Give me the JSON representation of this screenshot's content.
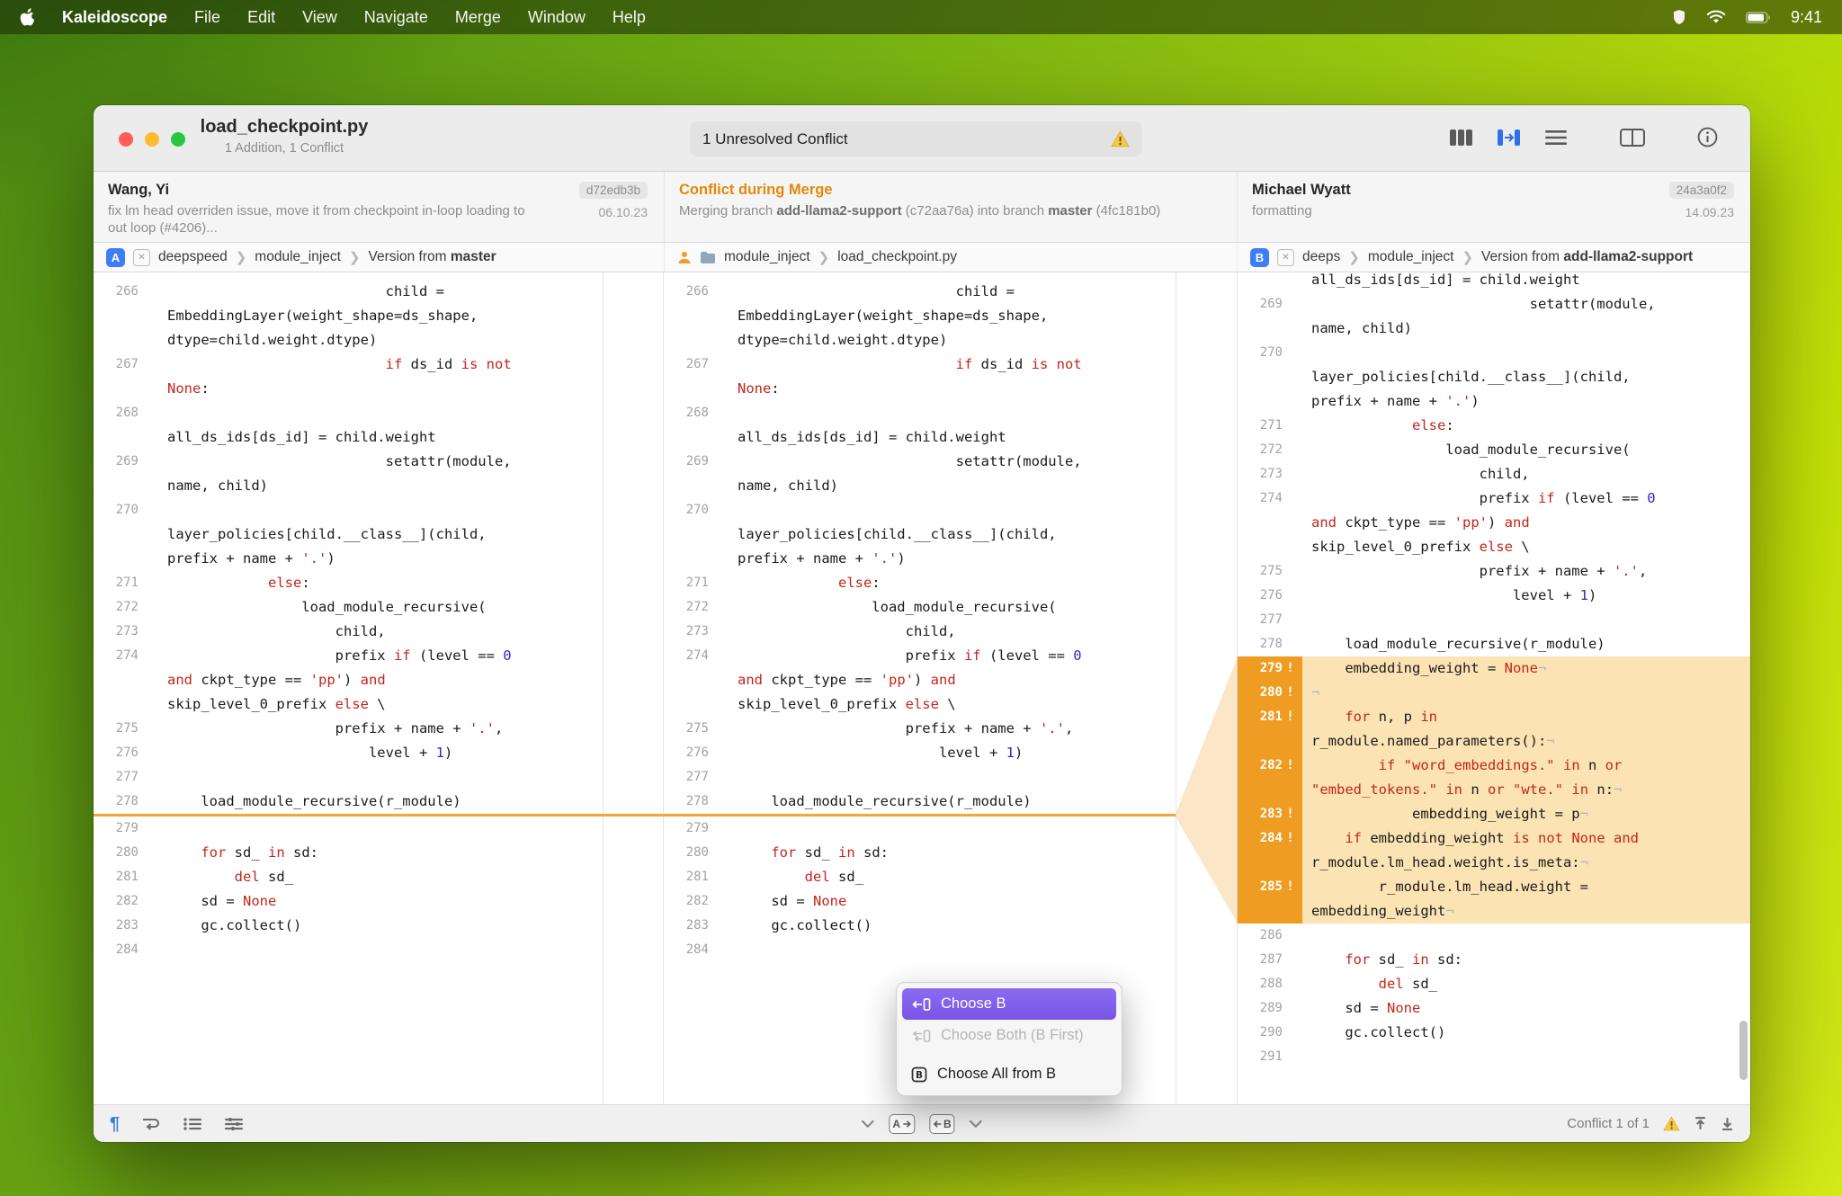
{
  "menubar": {
    "app_name": "Kaleidoscope",
    "menus": [
      "File",
      "Edit",
      "View",
      "Navigate",
      "Merge",
      "Window",
      "Help"
    ],
    "time": "9:41"
  },
  "titlebar": {
    "title": "load_checkpoint.py",
    "subtitle": "1 Addition, 1 Conflict",
    "banner": "1 Unresolved Conflict"
  },
  "commits": {
    "left": {
      "author": "Wang, Yi",
      "hash": "d72edb3b",
      "date": "06.10.23",
      "message": "fix lm head overriden issue, move it from checkpoint in-loop loading to out loop (#4206)..."
    },
    "middle": {
      "title": "Conflict during Merge",
      "pre": "Merging branch ",
      "branch_b": "add-llama2-support",
      "mid": " (c72aa76a) into branch ",
      "branch_a": "master",
      "post": " (4fc181b0)"
    },
    "right": {
      "author": "Michael Wyatt",
      "hash": "24a3a0f2",
      "date": "14.09.23",
      "message": "formatting"
    }
  },
  "crumbs": {
    "left": {
      "badge": "A",
      "s1": "deepspeed",
      "s2": "module_inject",
      "s3": "Version from ",
      "bold": "master"
    },
    "middle": {
      "s1": "module_inject",
      "s2": "load_checkpoint.py"
    },
    "right": {
      "badge": "B",
      "s1": "deeps",
      "s2": "module_inject",
      "s3": "Version from ",
      "bold": "add-llama2-support"
    }
  },
  "icons": {
    "menubar_right": [
      "shield-icon",
      "wifi-icon",
      "battery-icon"
    ],
    "view_modes": [
      "columns-view-icon",
      "merge-view-icon",
      "unified-view-icon",
      "fluid-view-icon",
      "info-icon"
    ],
    "statusbar_left": [
      "show-invisibles-icon",
      "wrap-lines-icon",
      "list-icon",
      "display-options-icon"
    ],
    "statusbar_center": [
      "chevron-down-icon",
      "choose-a-button",
      "choose-b-button",
      "chevron-down-icon"
    ],
    "statusbar_right": [
      "warning-icon",
      "previous-conflict-icon",
      "next-conflict-icon"
    ]
  },
  "popup": {
    "items": [
      {
        "label": "Choose B",
        "state": "selected"
      },
      {
        "label": "Choose Both (B First)",
        "state": "disabled"
      },
      {
        "label": "Choose All from B",
        "state": "normal"
      }
    ]
  },
  "statusbar": {
    "conflict_label": "Conflict 1 of 1"
  },
  "colors": {
    "accent_blue": "#3d7df5",
    "conflict_orange": "#e2890b",
    "highlight_gutter": "#ef9c23",
    "highlight_row": "#fbe3b4",
    "selection_purple": "#7a56e8"
  },
  "panes": {
    "ao": [
      {
        "n": "266",
        "r": [
          [
            [
              "p",
              "                          child ="
            ]
          ],
          [
            [
              "p",
              "EmbeddingLayer(weight_shape=ds_shape,"
            ]
          ],
          [
            [
              "p",
              "dtype=child.weight.dtype)"
            ]
          ]
        ]
      },
      {
        "n": "267",
        "r": [
          [
            [
              "p",
              "                          "
            ],
            [
              "k",
              "if"
            ],
            [
              "p",
              " ds_id "
            ],
            [
              "k",
              "is"
            ],
            [
              "p",
              " "
            ],
            [
              "k",
              "not"
            ]
          ],
          [
            [
              "k",
              "None"
            ],
            [
              "p",
              ":"
            ]
          ]
        ]
      },
      {
        "n": "268",
        "r": [
          [],
          [
            [
              "p",
              "all_ds_ids[ds_id] = child.weight"
            ]
          ]
        ]
      },
      {
        "n": "269",
        "r": [
          [
            [
              "p",
              "                          setattr(module,"
            ]
          ],
          [
            [
              "p",
              "name, child)"
            ]
          ]
        ]
      },
      {
        "n": "270",
        "r": [
          [],
          [
            [
              "p",
              "layer_policies[child.__class__](child,"
            ]
          ],
          [
            [
              "p",
              "prefix + name + "
            ],
            [
              "s",
              "'.'"
            ],
            [
              "p",
              ")"
            ]
          ]
        ]
      },
      {
        "n": "271",
        "r": [
          [
            [
              "p",
              "            "
            ],
            [
              "k",
              "else"
            ],
            [
              "p",
              ":"
            ]
          ]
        ]
      },
      {
        "n": "272",
        "r": [
          [
            [
              "p",
              "                load_module_recursive("
            ]
          ]
        ]
      },
      {
        "n": "273",
        "r": [
          [
            [
              "p",
              "                    child,"
            ]
          ]
        ]
      },
      {
        "n": "274",
        "r": [
          [
            [
              "p",
              "                    prefix "
            ],
            [
              "k",
              "if"
            ],
            [
              "p",
              " (level == "
            ],
            [
              "n",
              "0"
            ]
          ],
          [
            [
              "k",
              "and"
            ],
            [
              "p",
              " ckpt_type == "
            ],
            [
              "s",
              "'pp'"
            ],
            [
              "p",
              ") "
            ],
            [
              "k",
              "and"
            ]
          ],
          [
            [
              "p",
              "skip_level_0_prefix "
            ],
            [
              "k",
              "else"
            ],
            [
              "p",
              " \\"
            ]
          ]
        ]
      },
      {
        "n": "275",
        "r": [
          [
            [
              "p",
              "                    prefix + name + "
            ],
            [
              "s",
              "'.'"
            ],
            [
              "p",
              ","
            ]
          ]
        ]
      },
      {
        "n": "276",
        "r": [
          [
            [
              "p",
              "                        level + "
            ],
            [
              "n",
              "1"
            ],
            [
              "p",
              ")"
            ]
          ]
        ]
      },
      {
        "n": "277",
        "r": [
          []
        ]
      },
      {
        "n": "278",
        "r": [
          [
            [
              "p",
              "    load_module_recursive(r_module)"
            ]
          ]
        ]
      },
      {
        "mk": true
      },
      {
        "n": "279",
        "r": [
          []
        ]
      },
      {
        "n": "280",
        "r": [
          [
            [
              "p",
              "    "
            ],
            [
              "k",
              "for"
            ],
            [
              "p",
              " sd_ "
            ],
            [
              "k",
              "in"
            ],
            [
              "p",
              " sd:"
            ]
          ]
        ]
      },
      {
        "n": "281",
        "r": [
          [
            [
              "p",
              "        "
            ],
            [
              "k",
              "del"
            ],
            [
              "p",
              " sd_"
            ]
          ]
        ]
      },
      {
        "n": "282",
        "r": [
          [
            [
              "p",
              "    sd = "
            ],
            [
              "k",
              "None"
            ]
          ]
        ]
      },
      {
        "n": "283",
        "r": [
          [
            [
              "p",
              "    gc.collect()"
            ]
          ]
        ]
      },
      {
        "n": "284",
        "r": [
          []
        ]
      }
    ],
    "b": [
      {
        "n": "",
        "r": [
          [
            [
              "p",
              "all_ds_ids[ds_id] = child.weight"
            ]
          ]
        ]
      },
      {
        "n": "269",
        "r": [
          [
            [
              "p",
              "                          setattr(module,"
            ]
          ],
          [
            [
              "p",
              "name, child)"
            ]
          ]
        ]
      },
      {
        "n": "270",
        "r": [
          [],
          [
            [
              "p",
              "layer_policies[child.__class__](child,"
            ]
          ],
          [
            [
              "p",
              "prefix + name + "
            ],
            [
              "s",
              "'.'"
            ],
            [
              "p",
              ")"
            ]
          ]
        ]
      },
      {
        "n": "271",
        "r": [
          [
            [
              "p",
              "            "
            ],
            [
              "k",
              "else"
            ],
            [
              "p",
              ":"
            ]
          ]
        ]
      },
      {
        "n": "272",
        "r": [
          [
            [
              "p",
              "                load_module_recursive("
            ]
          ]
        ]
      },
      {
        "n": "273",
        "r": [
          [
            [
              "p",
              "                    child,"
            ]
          ]
        ]
      },
      {
        "n": "274",
        "r": [
          [
            [
              "p",
              "                    prefix "
            ],
            [
              "k",
              "if"
            ],
            [
              "p",
              " (level == "
            ],
            [
              "n",
              "0"
            ]
          ],
          [
            [
              "k",
              "and"
            ],
            [
              "p",
              " ckpt_type == "
            ],
            [
              "s",
              "'pp'"
            ],
            [
              "p",
              ") "
            ],
            [
              "k",
              "and"
            ]
          ],
          [
            [
              "p",
              "skip_level_0_prefix "
            ],
            [
              "k",
              "else"
            ],
            [
              "p",
              " \\"
            ]
          ]
        ]
      },
      {
        "n": "275",
        "r": [
          [
            [
              "p",
              "                    prefix + name + "
            ],
            [
              "s",
              "'.'"
            ],
            [
              "p",
              ","
            ]
          ]
        ]
      },
      {
        "n": "276",
        "r": [
          [
            [
              "p",
              "                        level + "
            ],
            [
              "n",
              "1"
            ],
            [
              "p",
              ")"
            ]
          ]
        ]
      },
      {
        "n": "277",
        "r": [
          []
        ]
      },
      {
        "n": "278",
        "r": [
          [
            [
              "p",
              "    load_module_recursive(r_module)"
            ]
          ]
        ]
      },
      {
        "n": "279",
        "h": true,
        "r": [
          [
            [
              "p",
              "    embedding_weight = "
            ],
            [
              "k",
              "None"
            ],
            [
              "m",
              "¬"
            ]
          ]
        ]
      },
      {
        "n": "280",
        "h": true,
        "r": [
          [
            [
              "m",
              "¬"
            ]
          ]
        ]
      },
      {
        "n": "281",
        "h": true,
        "r": [
          [
            [
              "p",
              "    "
            ],
            [
              "k",
              "for"
            ],
            [
              "p",
              " n, p "
            ],
            [
              "k",
              "in"
            ]
          ],
          [
            [
              "p",
              "r_module.named_parameters():"
            ],
            [
              "m",
              "¬"
            ]
          ]
        ]
      },
      {
        "n": "282",
        "h": true,
        "r": [
          [
            [
              "p",
              "        "
            ],
            [
              "k",
              "if"
            ],
            [
              "p",
              " "
            ],
            [
              "s",
              "\"word_embeddings.\""
            ],
            [
              "p",
              " "
            ],
            [
              "k",
              "in"
            ],
            [
              "p",
              " n "
            ],
            [
              "k",
              "or"
            ]
          ],
          [
            [
              "s",
              "\"embed_tokens.\""
            ],
            [
              "p",
              " "
            ],
            [
              "k",
              "in"
            ],
            [
              "p",
              " n "
            ],
            [
              "k",
              "or"
            ],
            [
              "p",
              " "
            ],
            [
              "s",
              "\"wte.\""
            ],
            [
              "p",
              " "
            ],
            [
              "k",
              "in"
            ],
            [
              "p",
              " n:"
            ],
            [
              "m",
              "¬"
            ]
          ]
        ]
      },
      {
        "n": "283",
        "h": true,
        "r": [
          [
            [
              "p",
              "            embedding_weight = p"
            ],
            [
              "m",
              "¬"
            ]
          ]
        ]
      },
      {
        "n": "284",
        "h": true,
        "r": [
          [
            [
              "p",
              "    "
            ],
            [
              "k",
              "if"
            ],
            [
              "p",
              " embedding_weight "
            ],
            [
              "k",
              "is"
            ],
            [
              "p",
              " "
            ],
            [
              "k",
              "not"
            ],
            [
              "p",
              " "
            ],
            [
              "k",
              "None"
            ],
            [
              "p",
              " "
            ],
            [
              "k",
              "and"
            ]
          ],
          [
            [
              "p",
              "r_module.lm_head.weight.is_meta:"
            ],
            [
              "m",
              "¬"
            ]
          ]
        ]
      },
      {
        "n": "285",
        "h": true,
        "r": [
          [
            [
              "p",
              "        r_module.lm_head.weight ="
            ]
          ],
          [
            [
              "p",
              "embedding_weight"
            ],
            [
              "m",
              "¬"
            ]
          ]
        ]
      },
      {
        "n": "286",
        "r": [
          []
        ]
      },
      {
        "n": "287",
        "r": [
          [
            [
              "p",
              "    "
            ],
            [
              "k",
              "for"
            ],
            [
              "p",
              " sd_ "
            ],
            [
              "k",
              "in"
            ],
            [
              "p",
              " sd:"
            ]
          ]
        ]
      },
      {
        "n": "288",
        "r": [
          [
            [
              "p",
              "        "
            ],
            [
              "k",
              "del"
            ],
            [
              "p",
              " sd_"
            ]
          ]
        ]
      },
      {
        "n": "289",
        "r": [
          [
            [
              "p",
              "    sd = "
            ],
            [
              "k",
              "None"
            ]
          ]
        ]
      },
      {
        "n": "290",
        "r": [
          [
            [
              "p",
              "    gc.collect()"
            ]
          ]
        ]
      },
      {
        "n": "291",
        "r": [
          []
        ]
      }
    ]
  }
}
